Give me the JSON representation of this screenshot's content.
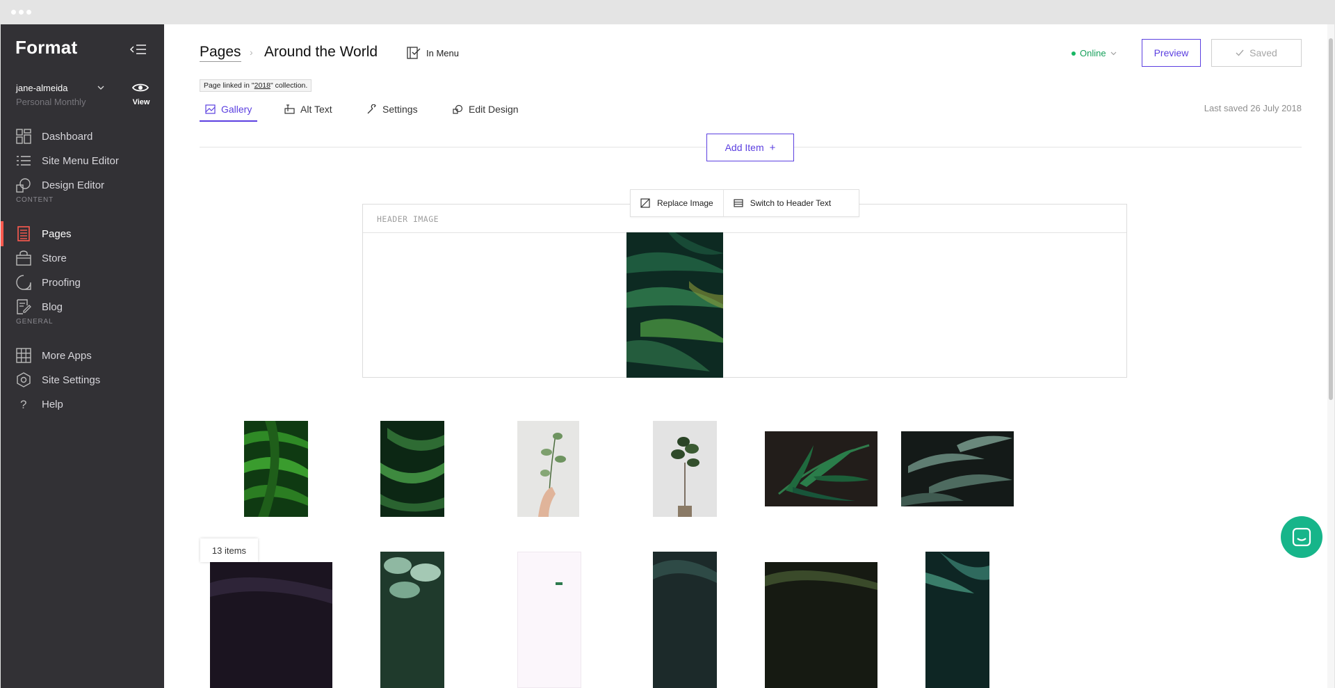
{
  "sidebar": {
    "brand": "Format",
    "account": {
      "name": "jane-almeida",
      "plan": "Personal Monthly",
      "view_label": "View"
    },
    "nav_main": [
      {
        "label": "Dashboard",
        "icon": "dashboard-icon"
      },
      {
        "label": "Site Menu Editor",
        "icon": "list-icon"
      },
      {
        "label": "Design Editor",
        "icon": "design-icon"
      }
    ],
    "content_heading": "CONTENT",
    "nav_content": [
      {
        "label": "Pages",
        "icon": "pages-icon",
        "active": true
      },
      {
        "label": "Store",
        "icon": "store-icon"
      },
      {
        "label": "Proofing",
        "icon": "proofing-icon"
      },
      {
        "label": "Blog",
        "icon": "blog-icon"
      }
    ],
    "general_heading": "GENERAL",
    "nav_general": [
      {
        "label": "More Apps",
        "icon": "grid-icon"
      },
      {
        "label": "Site Settings",
        "icon": "settings-icon"
      },
      {
        "label": "Help",
        "icon": "help-icon"
      }
    ]
  },
  "header": {
    "breadcrumb_root": "Pages",
    "page_title": "Around the World",
    "in_menu": "In Menu",
    "linked_prefix": "Page linked in \"",
    "linked_collection": "2018",
    "linked_suffix": "\" collection.",
    "status": "Online",
    "preview_label": "Preview",
    "saved_label": "Saved",
    "last_saved": "Last saved 26 July 2018"
  },
  "tabs": [
    {
      "label": "Gallery",
      "active": true
    },
    {
      "label": "Alt Text"
    },
    {
      "label": "Settings"
    },
    {
      "label": "Edit Design"
    }
  ],
  "gallery": {
    "add_item": "Add Item",
    "header_label": "HEADER IMAGE",
    "replace_image": "Replace Image",
    "switch_header": "Switch to Header Text",
    "items_count": "13 items"
  },
  "colors": {
    "accent": "#5b3fe0",
    "sidebar": "#323135",
    "active_marker": "#ff5a4f",
    "online": "#18b764",
    "chat": "#17b58a"
  }
}
